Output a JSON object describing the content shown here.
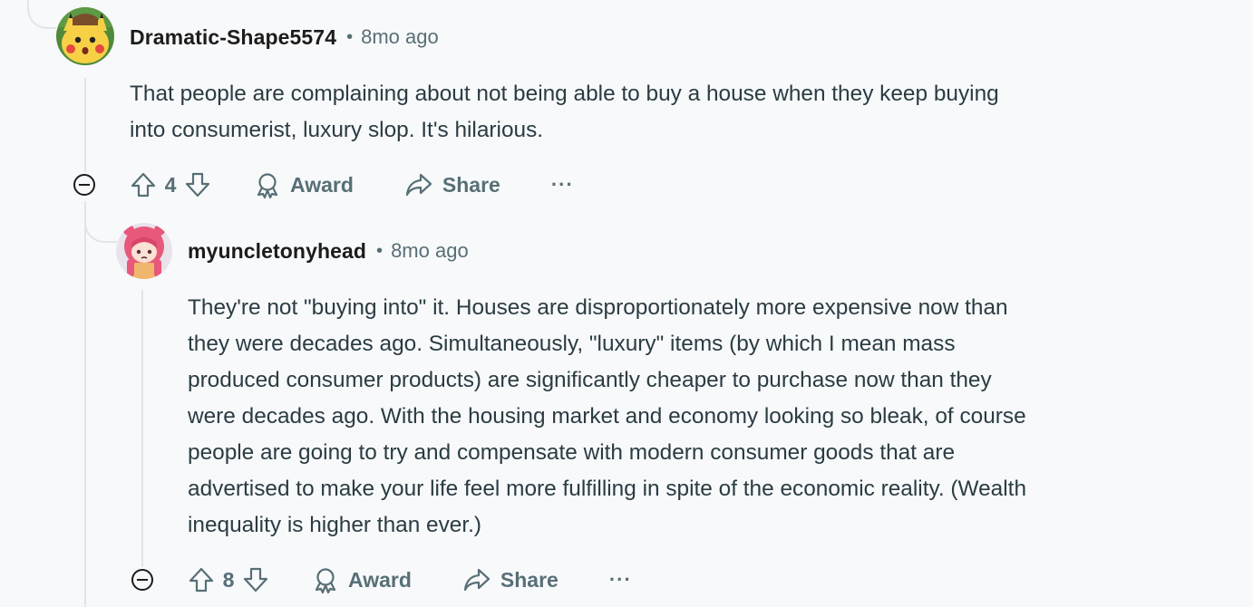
{
  "comments": [
    {
      "username": "Dramatic-Shape5574",
      "separator": "•",
      "time": "8mo ago",
      "body_lines": [
        "That people are complaining about not being able to buy a house when they keep buying",
        "into consumerist, luxury slop. It's hilarious."
      ],
      "votes": "4",
      "award_label": "Award",
      "share_label": "Share",
      "more_label": "···",
      "avatar_icon": "pikachu-avatar-icon"
    },
    {
      "username": "myuncletonyhead",
      "separator": "•",
      "time": "8mo ago",
      "body_lines": [
        "They're not \"buying into\" it. Houses are disproportionately more expensive now than",
        "they were decades ago. Simultaneously, \"luxury\" items (by which I mean mass",
        "produced consumer products) are significantly cheaper to purchase now than they",
        "were decades ago. With the housing market and economy looking so bleak, of course",
        "people are going to try and compensate with modern consumer goods that are",
        "advertised to make your life feel more fulfilling in spite of the economic reality. (Wealth",
        "inequality is higher than ever.)"
      ],
      "votes": "8",
      "award_label": "Award",
      "share_label": "Share",
      "more_label": "···",
      "avatar_icon": "pink-hair-avatar-icon"
    }
  ],
  "colors": {
    "background": "#f8f9fb",
    "meta": "#576f76",
    "body": "#2a3c42",
    "thread_line": "#e2e5e8"
  }
}
